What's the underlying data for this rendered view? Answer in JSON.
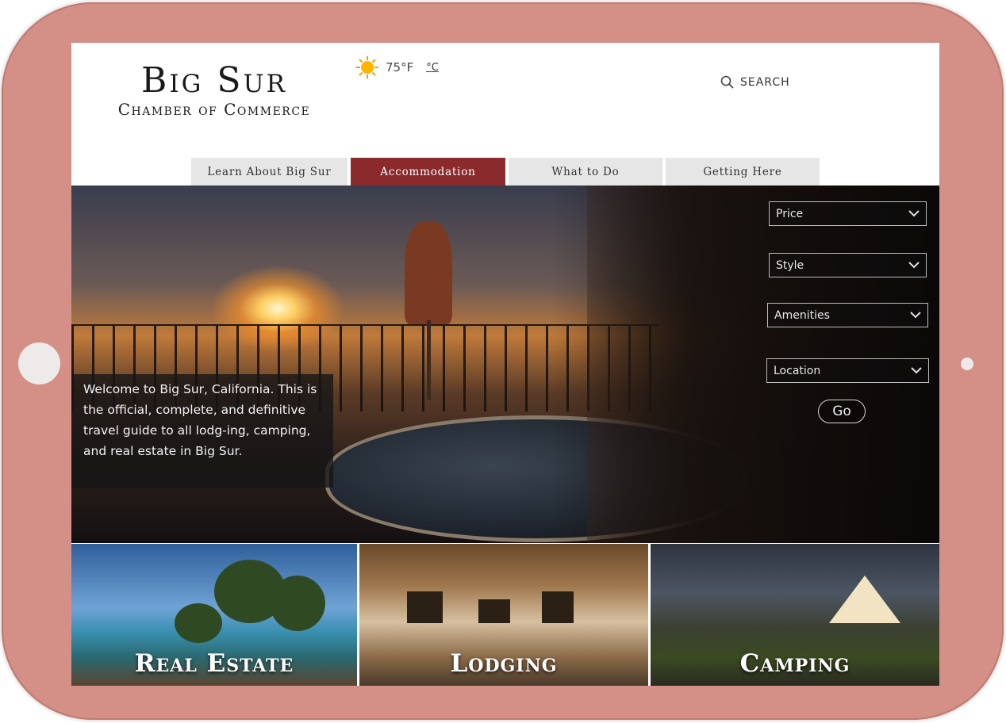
{
  "header": {
    "logo_line1": "Big Sur",
    "logo_line2": "Chamber of Commerce",
    "weather": {
      "icon": "sun-icon",
      "temperature": "75°F",
      "alt_unit": "°C"
    },
    "search_label": "SEARCH",
    "search_icon": "search-icon"
  },
  "nav": {
    "tabs": [
      {
        "label": "Learn About Big Sur",
        "active": false
      },
      {
        "label": "Accommodation",
        "active": true
      },
      {
        "label": "What to Do",
        "active": false
      },
      {
        "label": "Getting Here",
        "active": false
      }
    ]
  },
  "hero": {
    "welcome_text": "Welcome to Big Sur, California. This is the official, complete, and definitive travel guide to all lodg-ing, camping, and real estate in Big Sur."
  },
  "filters": {
    "price": "Price",
    "style": "Style",
    "amenities": "Amenities",
    "location": "Location",
    "go_label": "Go"
  },
  "tiles": {
    "real_estate": "Real Estate",
    "lodging": "Lodging",
    "camping": "Camping"
  },
  "colors": {
    "device_frame": "#d48f86",
    "accent_active_tab": "#8b2a2d",
    "tab_background": "#e6e6e6"
  }
}
